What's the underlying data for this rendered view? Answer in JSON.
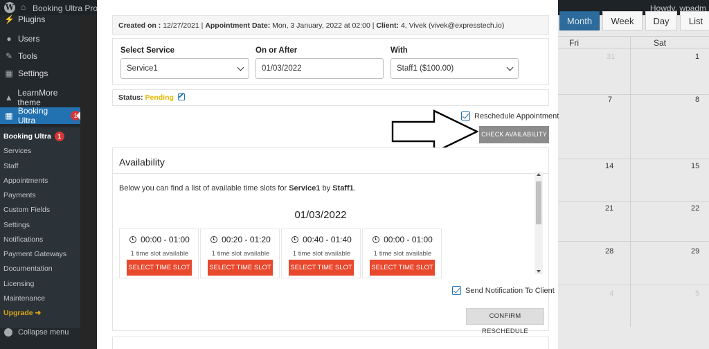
{
  "admin_bar": {
    "site_name": "Booking Ultra Pro",
    "howdy": "Howdy, wpadm"
  },
  "sidebar": {
    "items": [
      {
        "label": "Plugins"
      },
      {
        "label": "Users"
      },
      {
        "label": "Tools"
      },
      {
        "label": "Settings"
      },
      {
        "label": "LearnMore theme"
      },
      {
        "label": "Booking Ultra",
        "badge": "1"
      }
    ],
    "submenu": {
      "header": "Booking Ultra",
      "header_badge": "1",
      "items": [
        "Services",
        "Staff",
        "Appointments",
        "Payments",
        "Custom Fields",
        "Settings",
        "Notifications",
        "Payment Gateways",
        "Documentation",
        "Licensing",
        "Maintenance"
      ],
      "upgrade": "Upgrade ➜"
    },
    "collapse": "Collapse menu"
  },
  "calendar": {
    "view_buttons": [
      "Month",
      "Week",
      "Day",
      "List"
    ],
    "days": [
      "Fri",
      "Sat"
    ],
    "rows": [
      [
        "31",
        "1"
      ],
      [
        "7",
        "8"
      ],
      [
        "14",
        "15"
      ],
      [
        "21",
        "22"
      ],
      [
        "28",
        "29"
      ],
      [
        "4",
        "5"
      ]
    ]
  },
  "modal": {
    "info": {
      "created_label": "Created on :",
      "created_value": "12/27/2021",
      "appt_label": "Appointment Date:",
      "appt_value": "Mon, 3 January, 2022 at 02:00",
      "client_label": "Client:",
      "client_value": "4, Vivek (vivek@expresstech.io)"
    },
    "service_label": "Select Service",
    "service_value": "Service1",
    "date_label": "On or After",
    "date_value": "01/03/2022",
    "with_label": "With",
    "with_value": "Staff1 ($100.00)",
    "status_label": "Status:",
    "status_value": "Pending",
    "reschedule_label": "Reschedule Appointment",
    "check_button": "CHECK AVAILABILITY",
    "availability": {
      "title": "Availability",
      "desc_prefix": "Below you can find a list of available time slots for ",
      "desc_service": "Service1",
      "desc_by": " by ",
      "desc_staff": "Staff1",
      "desc_suffix": ".",
      "date": "01/03/2022",
      "slots": [
        {
          "time": "00:00 - 01:00",
          "available": "1 time slot available",
          "button": "SELECT TIME SLOT"
        },
        {
          "time": "00:20 - 01:20",
          "available": "1 time slot available",
          "button": "SELECT TIME SLOT"
        },
        {
          "time": "00:40 - 01:40",
          "available": "1 time slot available",
          "button": "SELECT TIME SLOT"
        },
        {
          "time": "00:00 - 01:00",
          "available": "1 time slot available",
          "button": "SELECT TIME SLOT"
        }
      ]
    },
    "notify_label": "Send Notification To Client",
    "confirm_button": "CONFIRM RESCHEDULE"
  }
}
